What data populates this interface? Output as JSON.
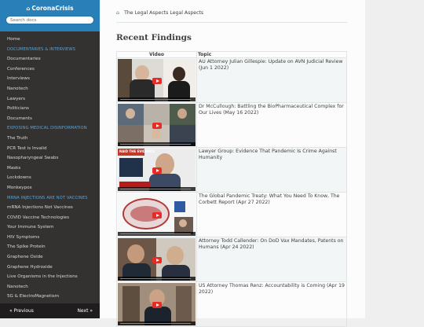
{
  "sidebar": {
    "brand": "CoronaCrisis",
    "search_placeholder": "Search docs",
    "nav": [
      {
        "type": "item",
        "label": "Home"
      },
      {
        "type": "caption",
        "label": "DOCUMENTARIES & INTERVIEWS"
      },
      {
        "type": "item",
        "label": "Documentaries"
      },
      {
        "type": "item",
        "label": "Conferences"
      },
      {
        "type": "item",
        "label": "Interviews"
      },
      {
        "type": "item",
        "label": "Nanotech"
      },
      {
        "type": "item",
        "label": "Lawyers"
      },
      {
        "type": "item",
        "label": "Politicians"
      },
      {
        "type": "item",
        "label": "Documents"
      },
      {
        "type": "caption",
        "label": "EXPOSING MEDICAL DISINFORMATION"
      },
      {
        "type": "item",
        "label": "The Truth"
      },
      {
        "type": "item",
        "label": "PCR Test is Invalid"
      },
      {
        "type": "item",
        "label": "Nasopharyngeal Swabs"
      },
      {
        "type": "item",
        "label": "Masks"
      },
      {
        "type": "item",
        "label": "Lockdowns"
      },
      {
        "type": "item",
        "label": "Monkeypox"
      },
      {
        "type": "caption",
        "label": "MRNA INJECTIONS ARE NOT VACCINES"
      },
      {
        "type": "item",
        "label": "mRNA Injections Not Vaccines"
      },
      {
        "type": "item",
        "label": "COVID Vaccine Technologies"
      },
      {
        "type": "item",
        "label": "Your Immune System"
      },
      {
        "type": "item",
        "label": "HIV Symptoms"
      },
      {
        "type": "item",
        "label": "The Spike Protein"
      },
      {
        "type": "item",
        "label": "Graphene Oxide"
      },
      {
        "type": "item",
        "label": "Graphene Hydroxide"
      },
      {
        "type": "item",
        "label": "Live Organisms in the Injections"
      },
      {
        "type": "item",
        "label": "Nanotech"
      },
      {
        "type": "item",
        "label": "5G & ElectroMagnetism"
      }
    ],
    "previous_label": "« Previous",
    "next_label": "Next »"
  },
  "breadcrumbs": {
    "home_icon": "home-icon",
    "path": "The Legal Aspects",
    "current": "Legal Aspects"
  },
  "page_title": "Recent Findings",
  "table": {
    "headers": [
      "Video",
      "Topic"
    ],
    "rows": [
      {
        "topic": "AU Attorney Julian Gillespie: Update on AVN Judicial Review (Jun 1 2022)"
      },
      {
        "topic": "Dr McCullough: Battling the BioPharmaceutical Complex for Our Lives (May 16 2022)"
      },
      {
        "topic": "Lawyer Group: Evidence That Pandemic Is Crime Against Humanity"
      },
      {
        "topic": "The Global Pandemic Treaty: What You Need To Know, The Corbett Report (Apr 27 2022)"
      },
      {
        "topic": "Attorney Todd Callender: On DoD Vax Mandates, Patents on Humans (Apr 24 2022)"
      },
      {
        "topic": "US Attorney Thomas Renz: Accountability is Coming (Apr 19 2022)"
      }
    ]
  },
  "thumb_overlay_text": "RAID THE EVIDENCE",
  "colors": {
    "sidebar_bg": "#343131",
    "brand_bg": "#2980b9",
    "caption": "#55a5d9",
    "page_bg": "#efefef",
    "play_red": "#e52d27"
  }
}
